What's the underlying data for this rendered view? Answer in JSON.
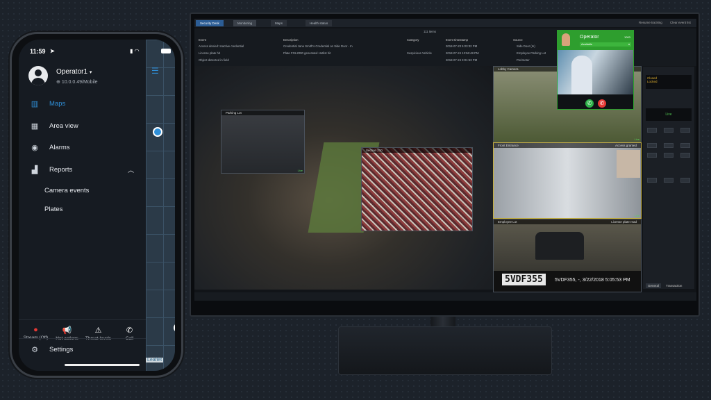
{
  "phone": {
    "status": {
      "time": "11:59",
      "location_icon": "location-arrow-icon",
      "signal_icon": "signal-icon",
      "wifi_icon": "wifi-icon",
      "battery_icon": "battery-icon"
    },
    "user": {
      "name": "Operator1",
      "address": "10.0.0.49/Mobile"
    },
    "menu": [
      {
        "label": "Maps",
        "icon": "map-icon",
        "active": true
      },
      {
        "label": "Area view",
        "icon": "building-icon"
      },
      {
        "label": "Alarms",
        "icon": "alarm-icon"
      },
      {
        "label": "Reports",
        "icon": "bar-chart-icon",
        "expanded": true
      }
    ],
    "submenu": [
      "Camera events",
      "Plates"
    ],
    "actions": [
      {
        "label": "Stream (Off)",
        "icon": "record-icon"
      },
      {
        "label": "Hot actions",
        "icon": "megaphone-icon"
      },
      {
        "label": "Threat levels",
        "icon": "siren-icon"
      },
      {
        "label": "Call",
        "icon": "phone-icon"
      }
    ],
    "settings_label": "Settings",
    "map_attribution": "Leaflet",
    "accent": "#2f8fd8"
  },
  "desktop": {
    "tabs": [
      "Security Desk",
      "Monitoring",
      "Maps",
      "Health status"
    ],
    "item_count": "111 items",
    "columns": [
      "Event",
      "Description",
      "Category",
      "Event timestamp",
      "Source"
    ],
    "rows": [
      [
        "Access denied: Inactive credential",
        "Credential Jane Smith's Credential on Side Door - In",
        "",
        "2018-07-23 5:23:32 PM",
        "Side Door (In)"
      ],
      [
        "License plate hit",
        "Plate FGL2000 generated Hotlist hit",
        "Suspicious Vehicle",
        "2018-07-24 12:56:48 PM",
        "Employee Parking Lot"
      ],
      [
        "Object detected in field",
        "",
        "",
        "2018-07-24 3:01:53 PM",
        "Perimeter"
      ]
    ],
    "top_actions": [
      "Resume tracking",
      "Clear event list"
    ],
    "tiles": {
      "parking": "Parking Lot",
      "section": "Section 210",
      "lobby": "Lobby Camera",
      "entrance": "Front Entrance",
      "access": "Access granted",
      "employee": "Employee Lot",
      "lpr_label": "License plate read",
      "plate": "5VDF355",
      "plate_read": "5VDF355, -, 3/22/2018 5:05:53 PM",
      "live": "Live"
    },
    "call": {
      "name": "Operator",
      "ext": "1003",
      "status": "Available",
      "accept_color": "#2fb34a",
      "decline_color": "#e53935",
      "header_color": "#2e9e2e"
    },
    "panel": {
      "doors": [
        "Closed",
        "Locked"
      ],
      "live_label": "Live",
      "tabs": [
        "General",
        "Transaction"
      ]
    }
  }
}
